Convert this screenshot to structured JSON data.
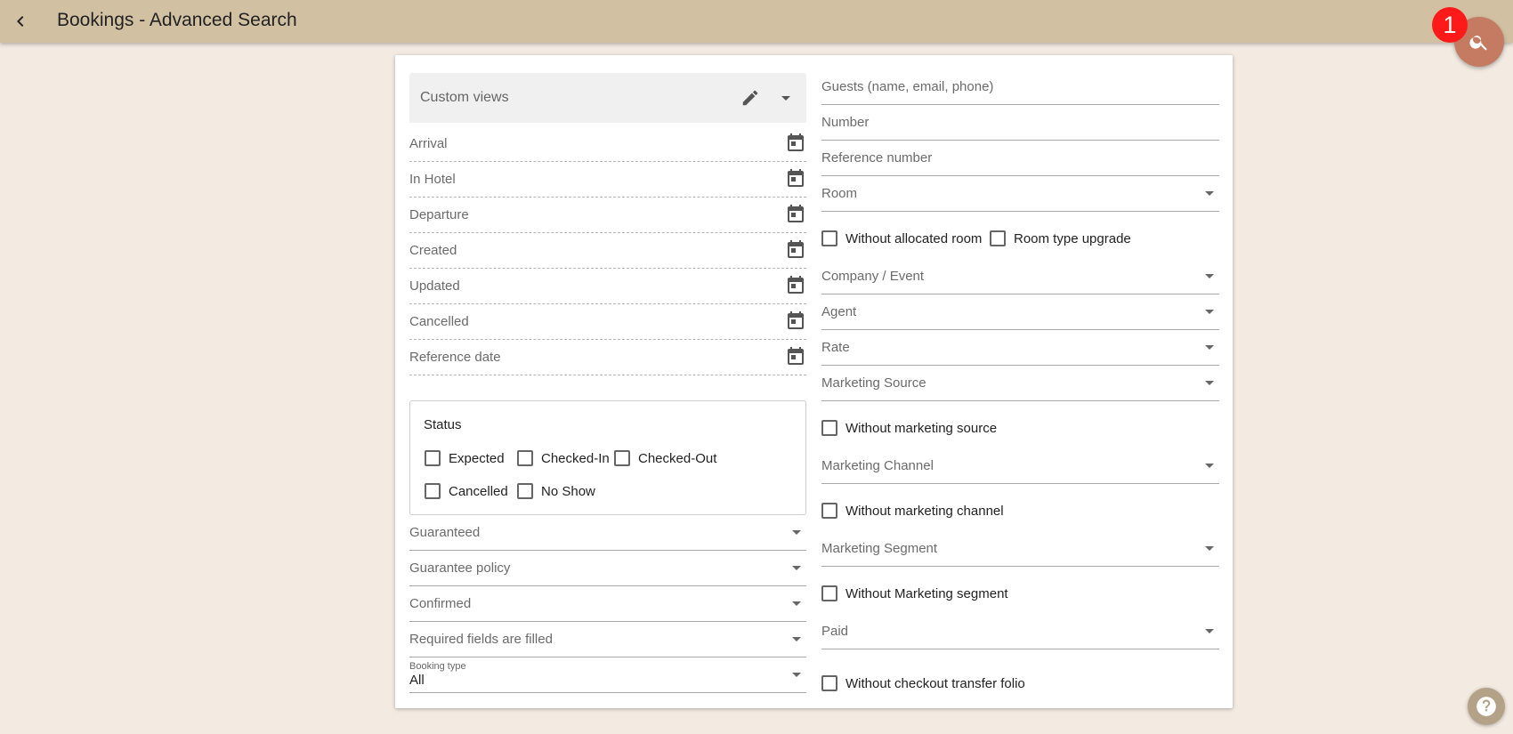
{
  "header": {
    "title": "Bookings - Advanced Search",
    "badge_count": "1",
    "background": "#d2c0a2"
  },
  "left": {
    "custom_views_label": "Custom views",
    "date_fields": [
      "Arrival",
      "In Hotel",
      "Departure",
      "Created",
      "Updated",
      "Cancelled",
      "Reference date"
    ],
    "status": {
      "title": "Status",
      "options": [
        "Expected",
        "Checked-In",
        "Checked-Out",
        "Cancelled",
        "No Show"
      ]
    },
    "selects": [
      "Guaranteed",
      "Guarantee policy",
      "Confirmed",
      "Required fields are filled"
    ],
    "booking_type": {
      "label": "Booking type",
      "value": "All"
    }
  },
  "right": {
    "guests_placeholder": "Guests (name, email, phone)",
    "number_placeholder": "Number",
    "reference_placeholder": "Reference number",
    "room_label": "Room",
    "without_allocated_room": "Without allocated room",
    "room_type_upgrade": "Room type upgrade",
    "company_event_label": "Company / Event",
    "agent_label": "Agent",
    "rate_label": "Rate",
    "marketing_source_label": "Marketing Source",
    "without_marketing_source": "Without marketing source",
    "marketing_channel_label": "Marketing Channel",
    "without_marketing_channel": "Without marketing channel",
    "marketing_segment_label": "Marketing Segment",
    "without_marketing_segment": "Without Marketing segment",
    "paid_label": "Paid",
    "without_checkout_transfer_folio": "Without checkout transfer folio"
  },
  "icons": {
    "back": "chevron-left-icon",
    "search": "search-icon",
    "edit": "pencil-icon",
    "calendar": "calendar-icon",
    "help": "help-icon"
  },
  "colors": {
    "page_background": "#f3ebe2",
    "search_fab": "#c47b62",
    "badge": "#ff1a1a",
    "help_fab": "#b4a288"
  }
}
